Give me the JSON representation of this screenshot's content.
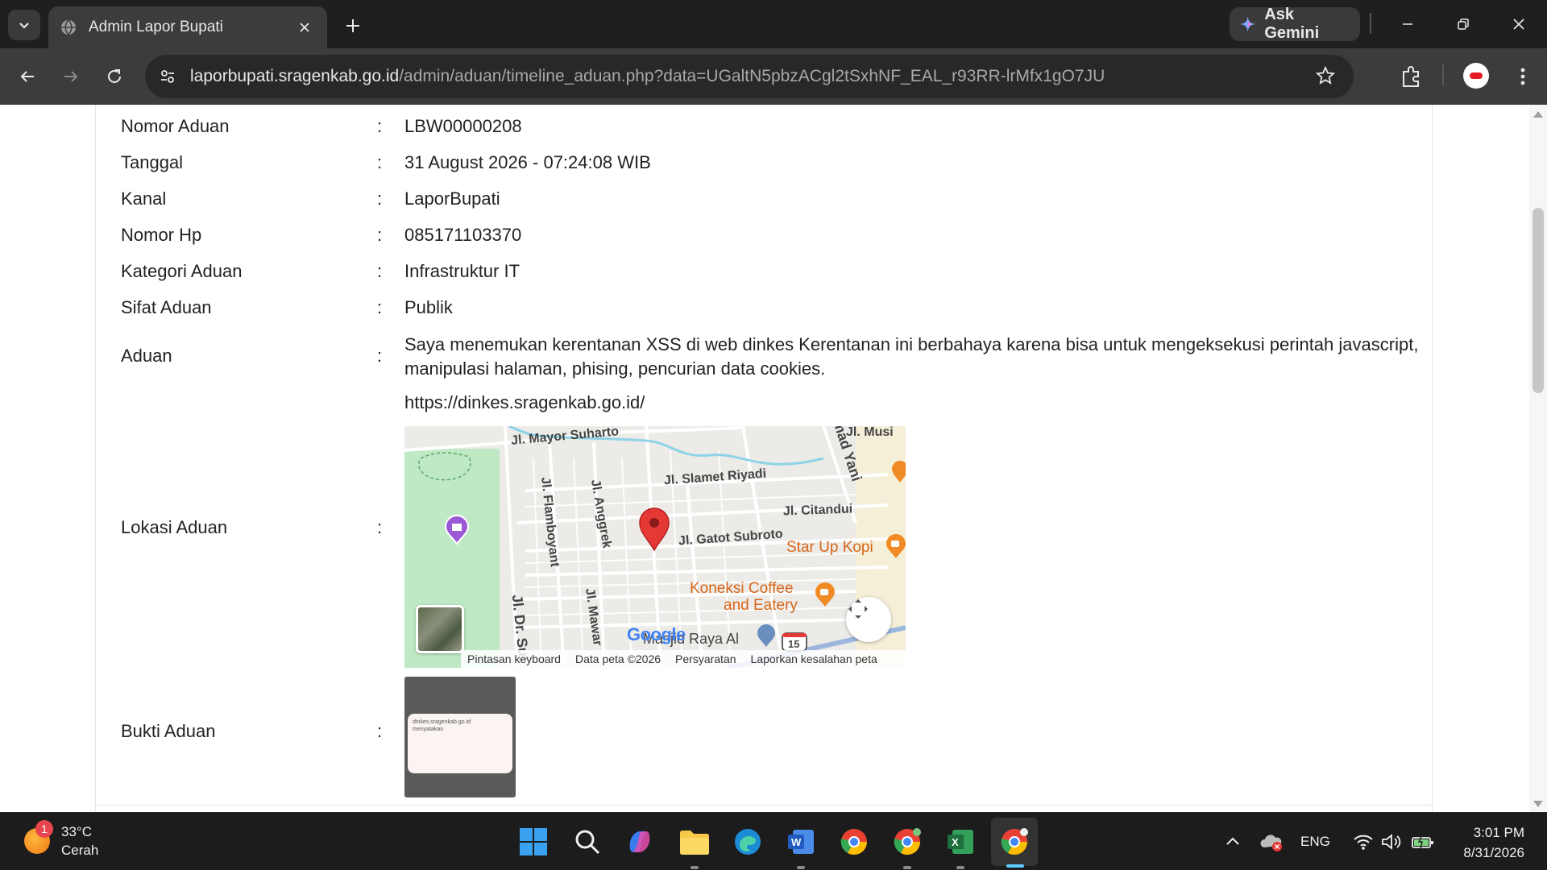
{
  "browser": {
    "tab_title": "Admin Lapor Bupati",
    "gemini_label": "Ask Gemini",
    "url_host": "laporbupati.sragenkab.go.id",
    "url_path": "/admin/aduan/timeline_aduan.php?data=UGaltN5pbzACgl2tSxhNF_EAL_r93RR-lrMfx1gO7JU"
  },
  "details": {
    "colon": ":",
    "nomor_aduan": {
      "label": "Nomor Aduan",
      "value": "LBW00000208"
    },
    "tanggal": {
      "label": "Tanggal",
      "value": "31 August 2026 - 07:24:08 WIB"
    },
    "kanal": {
      "label": "Kanal",
      "value": "LaporBupati"
    },
    "nomor_hp": {
      "label": "Nomor Hp",
      "value": "085171103370"
    },
    "kategori": {
      "label": "Kategori Aduan",
      "value": "Infrastruktur IT"
    },
    "sifat": {
      "label": "Sifat Aduan",
      "value": "Publik"
    },
    "aduan": {
      "label": "Aduan",
      "text": "Saya menemukan kerentanan XSS di web dinkes Kerentanan ini berbahaya karena bisa untuk mengeksekusi perintah javascript, manipulasi halaman, phising, pencurian data cookies.",
      "link": "https://dinkes.sragenkab.go.id/"
    },
    "lokasi": {
      "label": "Lokasi Aduan"
    },
    "bukti": {
      "label": "Bukti Aduan",
      "preview_line1": "dinkes.sragenkab.go.id",
      "preview_line2": "menyatakan"
    }
  },
  "map": {
    "streets": [
      "Jl. Mayor Suharto",
      "Jl. Musi",
      "mad Yani",
      "Jl. Slamet Riyadi",
      "Jl. Citandui",
      "Jl. Flamboyant",
      "Jl. Anggrek",
      "Jl. Gatot Subroto",
      "Jl. Dr. Sut",
      "Jl. Mawar",
      "Masjid Raya Al"
    ],
    "pois": [
      "Star Up Kopi",
      "Koneksi Coffee",
      "and Eatery"
    ],
    "route_badge": "15",
    "logo": "Google",
    "footer": [
      "Pintasan keyboard",
      "Data peta ©2026",
      "Persyaratan",
      "Laporkan kesalahan peta"
    ]
  },
  "taskbar": {
    "weather_temp": "33°C",
    "weather_desc": "Cerah",
    "weather_badge": "1",
    "lang": "ENG",
    "time": "3:01 PM",
    "date": "8/31/2026"
  }
}
